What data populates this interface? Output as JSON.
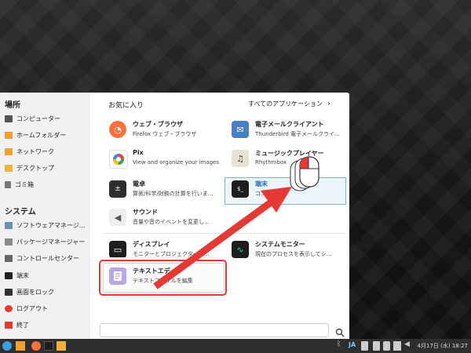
{
  "sidebar": {
    "places_heading": "場所",
    "places": [
      {
        "label": "コンピューター",
        "icon": "computer-icon"
      },
      {
        "label": "ホームフォルダー",
        "icon": "home-folder-icon"
      },
      {
        "label": "ネットワーク",
        "icon": "network-folder-icon"
      },
      {
        "label": "デスクトップ",
        "icon": "desktop-folder-icon"
      },
      {
        "label": "ゴミ箱",
        "icon": "trash-icon"
      }
    ],
    "system_heading": "システム",
    "system": [
      {
        "label": "ソフトウェアマネージ…",
        "icon": "software-manager-icon"
      },
      {
        "label": "パッケージマネージャー",
        "icon": "package-manager-icon"
      },
      {
        "label": "コントロールセンター",
        "icon": "control-center-icon"
      },
      {
        "label": "端末",
        "icon": "terminal-icon"
      },
      {
        "label": "画面をロック",
        "icon": "lock-screen-icon"
      },
      {
        "label": "ログアウト",
        "icon": "logout-icon"
      },
      {
        "label": "終了",
        "icon": "power-icon"
      }
    ]
  },
  "main": {
    "favorites_title": "お気に入り",
    "all_apps_label": "すべてのアプリケーション",
    "apps": [
      {
        "name": "ウェブ・ブラウザ",
        "desc": "Firefox ウェブ・ブラウザ",
        "icon": "firefox-icon"
      },
      {
        "name": "電子メールクライアント",
        "desc": "Thunderbird 電子メールクライ…",
        "icon": "mail-icon"
      },
      {
        "name": "Pix",
        "desc": "View and organize your images",
        "icon": "pix-icon"
      },
      {
        "name": "ミュージックプレイヤー",
        "desc": "Rhythmbox",
        "icon": "music-icon"
      },
      {
        "name": "電卓",
        "desc": "算術/科学/財務の計算を行いま…",
        "icon": "calculator-icon"
      },
      {
        "name": "端末",
        "desc": "コ…を使用",
        "icon": "terminal-icon"
      },
      {
        "name": "サウンド",
        "desc": "音量や音のイベントを変更し…",
        "icon": "sound-icon"
      },
      {
        "name": "ディスプレイ",
        "desc": "モニターとプロジェクターの…",
        "icon": "display-icon"
      },
      {
        "name": "システムモニター",
        "desc": "現在のプロセスを表示してシ…",
        "icon": "system-monitor-icon"
      },
      {
        "name": "テキストエディタ",
        "desc": "テキストファイルを編集",
        "icon": "text-editor-icon"
      }
    ]
  },
  "taskbar": {
    "input_method": "JA",
    "clock": "4月17日 (水) 18:27"
  },
  "colors": {
    "highlight_box": "#e53935",
    "arrow": "#e53935"
  }
}
